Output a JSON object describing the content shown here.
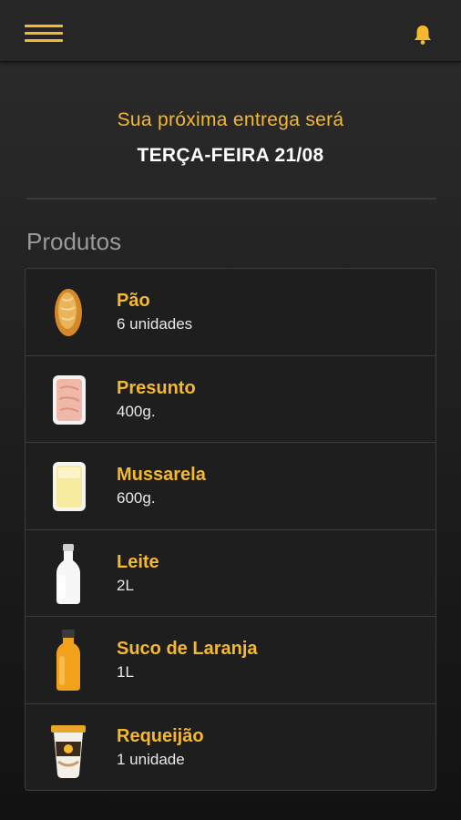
{
  "header": {
    "menu_icon": "hamburger-menu-icon",
    "notification_icon": "bell-icon",
    "accent_color": "#f5b82e"
  },
  "delivery": {
    "label": "Sua próxima entrega será",
    "date": "TERÇA-FEIRA 21/08"
  },
  "products_section": {
    "title": "Produtos",
    "items": [
      {
        "name": "Pão",
        "quantity": "6 unidades",
        "icon": "bread-icon"
      },
      {
        "name": "Presunto",
        "quantity": "400g.",
        "icon": "ham-package-icon"
      },
      {
        "name": "Mussarela",
        "quantity": "600g.",
        "icon": "cheese-package-icon"
      },
      {
        "name": "Leite",
        "quantity": "2L",
        "icon": "milk-bottle-icon"
      },
      {
        "name": "Suco de Laranja",
        "quantity": "1L",
        "icon": "orange-juice-bottle-icon"
      },
      {
        "name": "Requeijão",
        "quantity": "1 unidade",
        "icon": "cream-cheese-cup-icon"
      }
    ]
  }
}
